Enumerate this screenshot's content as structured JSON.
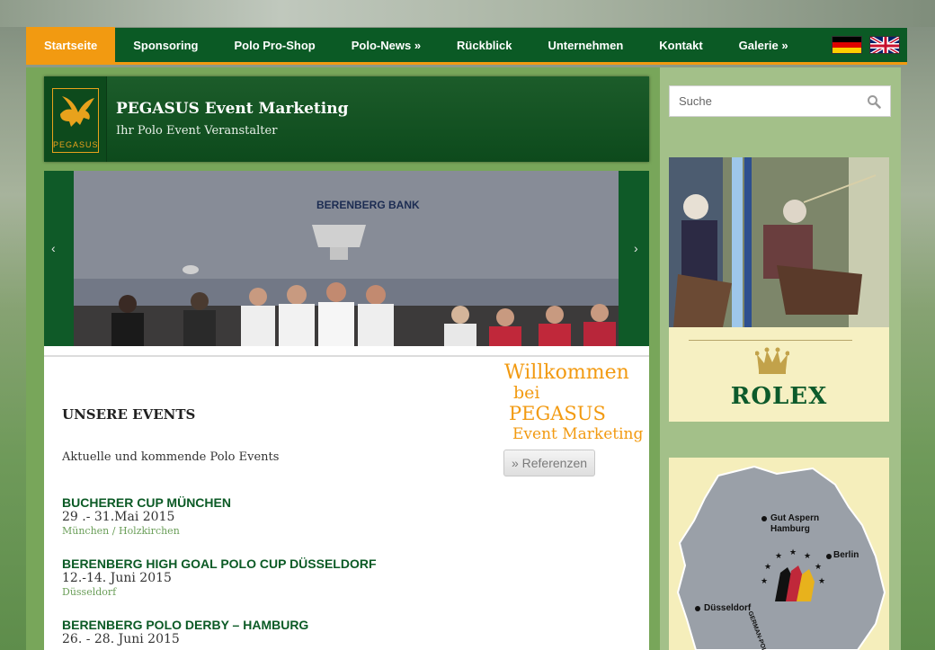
{
  "nav": {
    "items": [
      {
        "label": "Startseite",
        "active": true
      },
      {
        "label": "Sponsoring"
      },
      {
        "label": "Polo Pro-Shop"
      },
      {
        "label": "Polo-News »"
      },
      {
        "label": "Rückblick"
      },
      {
        "label": "Unternehmen"
      },
      {
        "label": "Kontakt"
      },
      {
        "label": "Galerie »"
      }
    ],
    "active_color": "#f29a11",
    "bar_color": "#0b5a25"
  },
  "header": {
    "logo_text": "PEGASUS",
    "title": "PEGASUS Event Marketing",
    "tagline": "Ihr Polo Event Veranstalter"
  },
  "slider": {
    "prev": "‹",
    "next": "›",
    "banner_text": "BERENBERG BANK"
  },
  "events": {
    "heading": "UNSERE EVENTS",
    "subtitle": "Aktuelle und kommende Polo Events",
    "items": [
      {
        "title": "BUCHERER CUP MÜNCHEN",
        "date": "29 .- 31.Mai 2015",
        "location": "München / Holzkirchen"
      },
      {
        "title": "BERENBERG HIGH GOAL POLO CUP DÜSSELDORF",
        "date": "12.-14. Juni 2015",
        "location": "Düsseldorf"
      },
      {
        "title": "BERENBERG POLO DERBY – HAMBURG",
        "date": "26. - 28. Juni 2015",
        "location": ""
      }
    ]
  },
  "welcome": {
    "line1": "Willkommen",
    "line2": "bei",
    "line3": "PEGASUS",
    "line4": "Event Marketing",
    "button": "» Referenzen"
  },
  "sidebar": {
    "search_placeholder": "Suche",
    "ad_brand": "ROLEX",
    "map_cities": [
      "Gut Aspern",
      "Hamburg",
      "Berlin",
      "Düsseldorf"
    ],
    "map_tour": "GERMAN-POLO-TOUR"
  }
}
